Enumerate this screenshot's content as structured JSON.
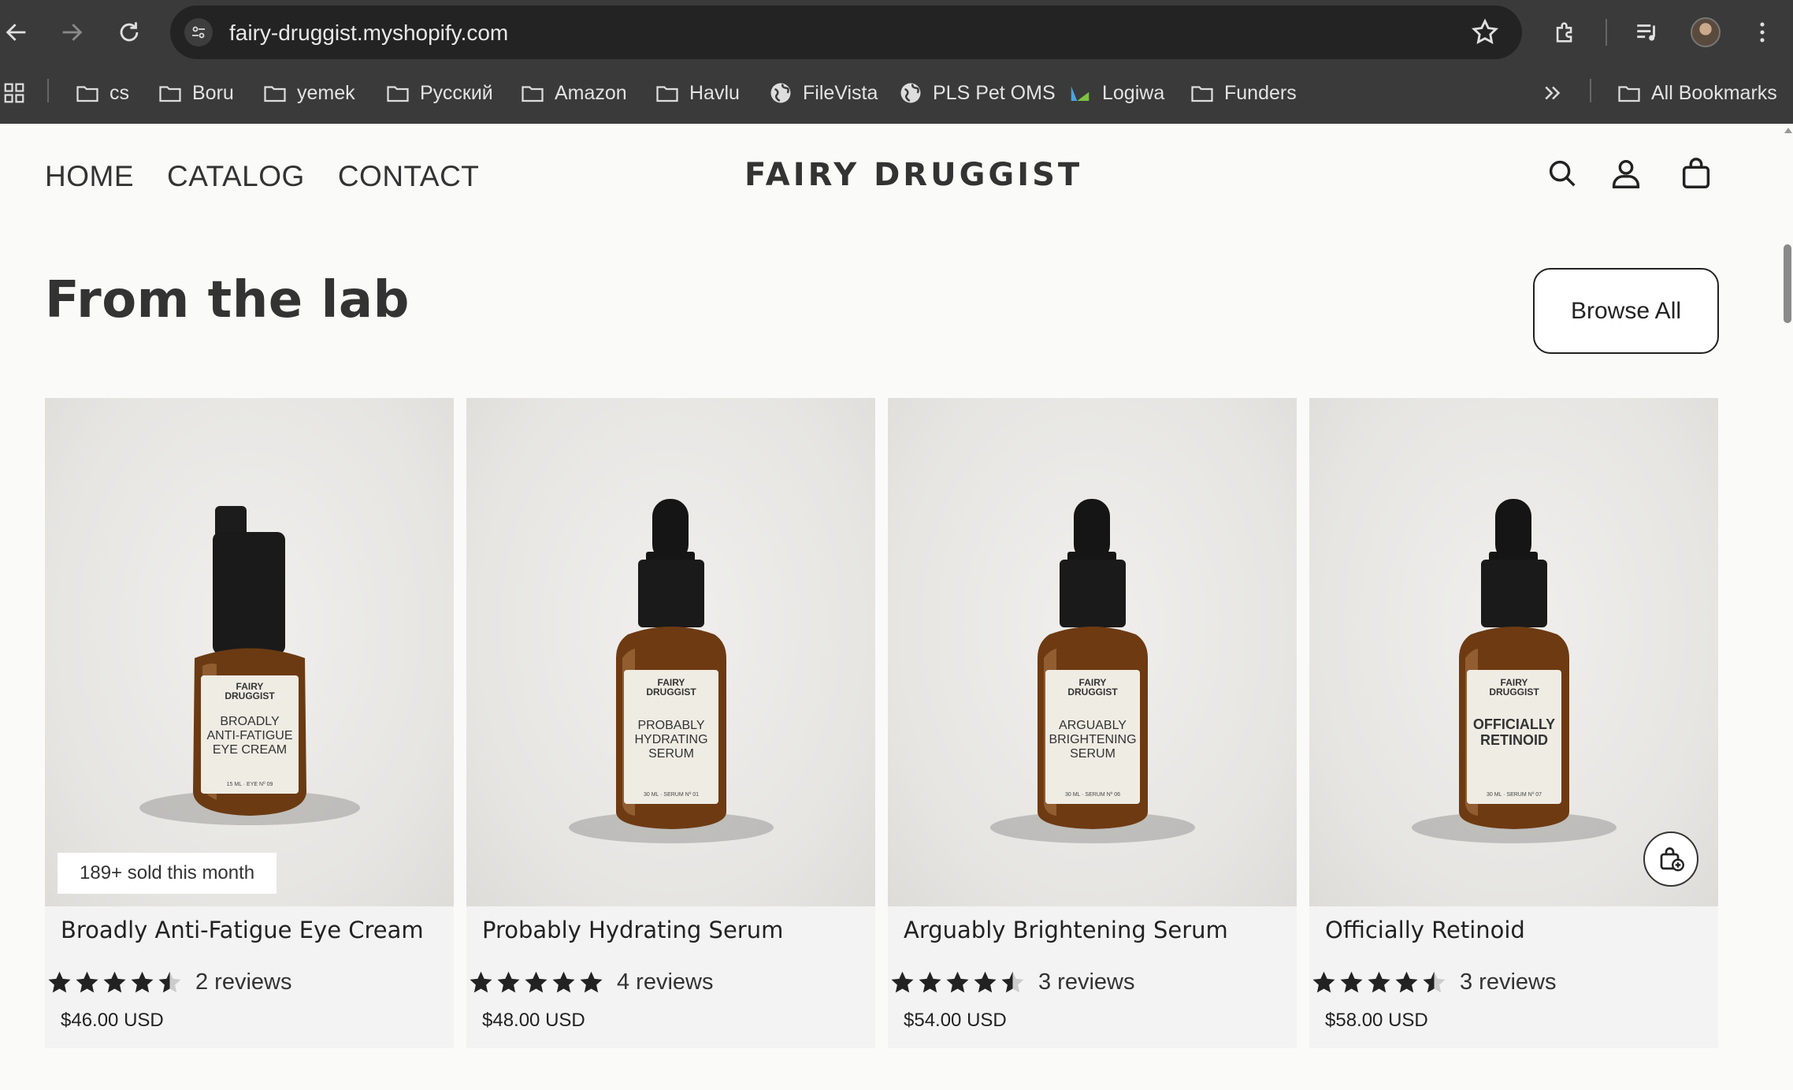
{
  "browser": {
    "url": "fairy-druggist.myshopify.com",
    "bookmarks": [
      {
        "label": "cs",
        "icon": "folder-icon"
      },
      {
        "label": "Boru",
        "icon": "folder-icon"
      },
      {
        "label": "yemek",
        "icon": "folder-icon"
      },
      {
        "label": "Русский",
        "icon": "folder-icon"
      },
      {
        "label": "Amazon",
        "icon": "folder-icon"
      },
      {
        "label": "Havlu",
        "icon": "folder-icon"
      },
      {
        "label": "FileVista",
        "icon": "globe-icon"
      },
      {
        "label": "PLS Pet OMS",
        "icon": "globe-icon"
      },
      {
        "label": "Logiwa",
        "icon": "logiwa-icon"
      },
      {
        "label": "Funders",
        "icon": "folder-icon"
      }
    ],
    "all_bookmarks": "All Bookmarks"
  },
  "store": {
    "nav": [
      "HOME",
      "CATALOG",
      "CONTACT"
    ],
    "brand": "FAIRY DRUGGIST"
  },
  "section": {
    "title": "From the lab",
    "browse_label": "Browse All"
  },
  "products": [
    {
      "name": "Broadly Anti-Fatigue Eye Cream",
      "rating": 4.5,
      "reviews": "2 reviews",
      "price": "$46.00 USD",
      "badge": "189+ sold this month",
      "bottle": "pump",
      "label": {
        "brand": [
          "FAIRY",
          "DRUGGIST"
        ],
        "product": [
          "BROADLY",
          "ANTI-FATIGUE",
          "EYE CREAM"
        ],
        "fine": "15 ML · EYE Nº 09"
      }
    },
    {
      "name": "Probably Hydrating Serum",
      "rating": 5,
      "reviews": "4 reviews",
      "price": "$48.00 USD",
      "badge": "",
      "bottle": "dropper",
      "label": {
        "brand": [
          "FAIRY",
          "DRUGGIST"
        ],
        "product": [
          "PROBABLY",
          "HYDRATING",
          "SERUM"
        ],
        "fine": "30 ML · SERUM Nº 01"
      }
    },
    {
      "name": "Arguably Brightening Serum",
      "rating": 4.5,
      "reviews": "3 reviews",
      "price": "$54.00 USD",
      "badge": "",
      "bottle": "dropper",
      "label": {
        "brand": [
          "FAIRY",
          "DRUGGIST"
        ],
        "product": [
          "ARGUABLY",
          "BRIGHTENING",
          "SERUM"
        ],
        "fine": "30 ML · SERUM Nº 06"
      }
    },
    {
      "name": "Officially Retinoid",
      "rating": 4.5,
      "reviews": "3 reviews",
      "price": "$58.00 USD",
      "badge": "",
      "bottle": "dropper",
      "quick_add": true,
      "label": {
        "brand": [
          "FAIRY",
          "DRUGGIST"
        ],
        "product": [
          "OFFICIALLY",
          "RETINOID"
        ],
        "fine": "30 ML · SERUM Nº 07"
      }
    }
  ],
  "colors": {
    "chrome_bg": "#3a3a3a",
    "omnibox_bg": "#232323",
    "page_bg": "#fafaf8",
    "card_bg": "#f3f3f3",
    "amber_glass": "#6b3a12",
    "star": "#222222"
  }
}
